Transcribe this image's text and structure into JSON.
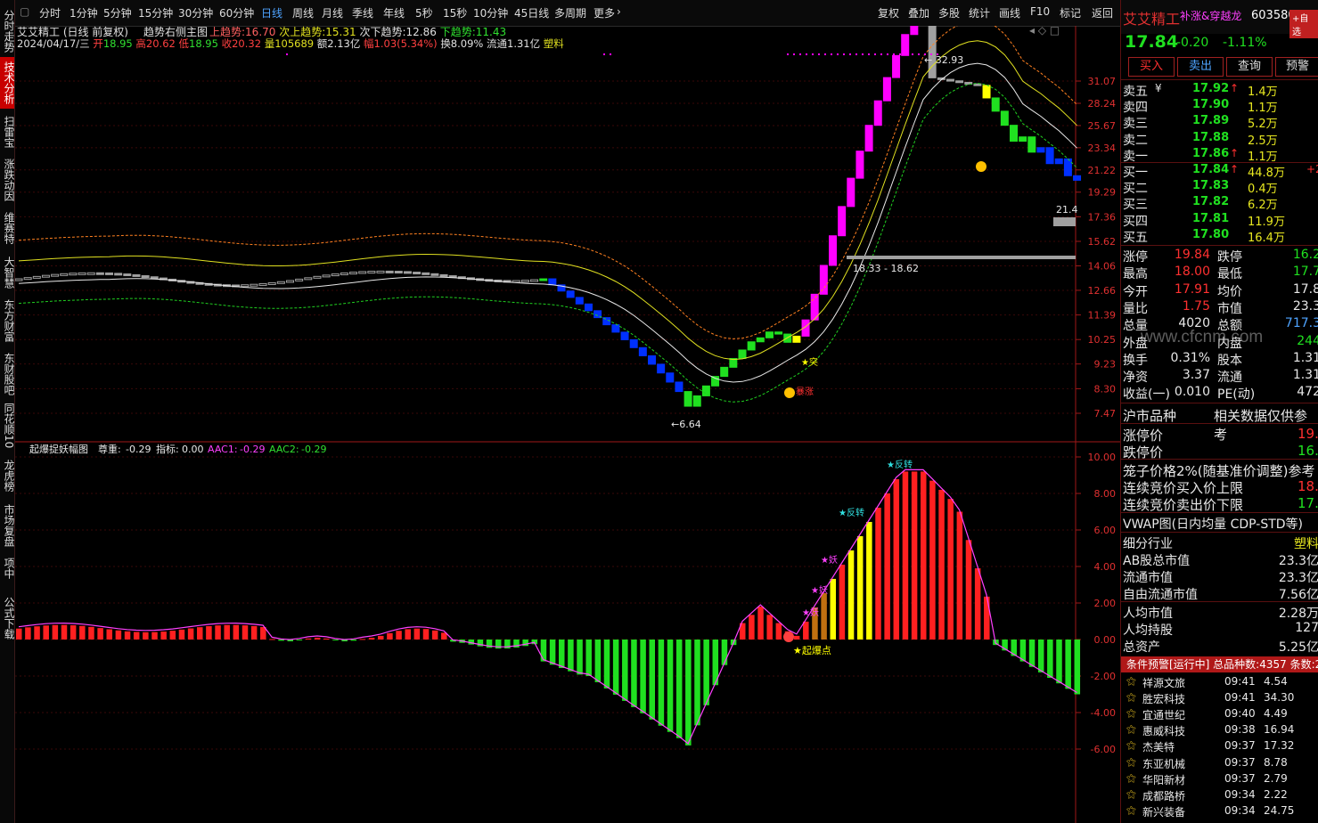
{
  "toolbar": {
    "periods": [
      "分时",
      "1分钟",
      "5分钟",
      "15分钟",
      "30分钟",
      "60分钟",
      "日线",
      "周线",
      "月线",
      "季线",
      "年线",
      "5秒",
      "15秒",
      "10分钟",
      "45日线",
      "多周期",
      "更多"
    ],
    "active": "日线",
    "actions": [
      "复权",
      "叠加",
      "多股",
      "统计",
      "画线",
      "F10",
      "标记",
      "返回"
    ]
  },
  "sidebar": {
    "tabs": [
      "分时走势",
      "技术分析",
      "扫雷宝",
      "涨跌动因",
      "维赛特",
      "大智慧",
      "东方财富",
      "东财股吧",
      "同花顺10",
      "龙虎榜",
      "市场复盘",
      "项中",
      "公式下载"
    ],
    "selected": "技术分析"
  },
  "main_chart": {
    "header_title": "艾艾精工 (日线 前复权)",
    "indicator_name": "趋势右侧主图",
    "ind1_label": "上趋势:",
    "ind1_value": "16.70",
    "ind2_label": "次上趋势:",
    "ind2_value": "15.31",
    "ind3_label": "次下趋势:",
    "ind3_value": "12.86",
    "ind4_label": "下趋势:",
    "ind4_value": "11.43",
    "date": "2024/04/17/三",
    "open_label": "开",
    "open": "18.95",
    "high_label": "高",
    "high": "20.62",
    "low_label": "低",
    "low": "18.95",
    "close_label": "收",
    "close": "20.32",
    "vol_label": "量",
    "vol": "105689",
    "amt_label": "额",
    "amt": "2.13亿",
    "chg_label": "幅",
    "chg": "1.03(5.34%)",
    "turnover": "换8.09%",
    "float": "流通1.31亿",
    "sector": "塑料",
    "high_marker": "32.93",
    "low_marker": "6.64",
    "range_label": "18.33 - 18.62",
    "right_price_tag": "21.4",
    "label_tu": "突",
    "label_bao": "暴涨",
    "axis": [
      "31.07",
      "28.24",
      "25.67",
      "23.34",
      "21.22",
      "19.29",
      "17.36",
      "15.62",
      "14.06",
      "12.66",
      "11.39",
      "10.25",
      "9.23",
      "8.30",
      "7.47"
    ]
  },
  "sub_chart": {
    "title": "起爆捉妖幅图",
    "zunzhong_label": "尊重:",
    "zunzhong": "-0.29",
    "zhibiao_label": "指标:",
    "zhibiao": "0.00",
    "aac1_label": "AAC1:",
    "aac1": "-0.29",
    "aac2_label": "AAC2:",
    "aac2": "-0.29",
    "axis": [
      "10.00",
      "8.00",
      "6.00",
      "4.00",
      "2.00",
      "0.00",
      "-2.00",
      "-4.00",
      "-6.00"
    ],
    "label_qibao": "★起爆点",
    "label_fanzhuan1": "★反转",
    "label_fanzhuan2": "★反转",
    "label_yao1": "★妖",
    "label_yao2": "★妖",
    "label_yao3": "★妖"
  },
  "panel": {
    "name": "艾艾精工",
    "tags": "补涨&穿越龙",
    "code": "603580",
    "add_btn": "+自选",
    "price": "17.84",
    "change": "-0.20",
    "pct": "-1.11%",
    "btn_buy": "买入",
    "btn_sell": "卖出",
    "btn_query": "查询",
    "btn_alert": "预警",
    "asks": [
      {
        "label": "卖五",
        "price": "17.92",
        "vol": "1.4万",
        "mark": "¥"
      },
      {
        "label": "卖四",
        "price": "17.90",
        "vol": "1.1万",
        "mark": ""
      },
      {
        "label": "卖三",
        "price": "17.89",
        "vol": "5.2万",
        "mark": ""
      },
      {
        "label": "卖二",
        "price": "17.88",
        "vol": "2.5万",
        "mark": ""
      },
      {
        "label": "卖一",
        "price": "17.86",
        "vol": "1.1万",
        "mark": "↑"
      }
    ],
    "bids": [
      {
        "label": "买一",
        "price": "17.84",
        "vol": "44.8万",
        "mark": "↑",
        "extra": "+2"
      },
      {
        "label": "买二",
        "price": "17.83",
        "vol": "0.4万",
        "mark": "",
        "extra": ""
      },
      {
        "label": "买三",
        "price": "17.82",
        "vol": "6.2万",
        "mark": "",
        "extra": ""
      },
      {
        "label": "买四",
        "price": "17.81",
        "vol": "11.9万",
        "mark": "",
        "extra": ""
      },
      {
        "label": "买五",
        "price": "17.80",
        "vol": "16.4万",
        "mark": "",
        "extra": ""
      }
    ],
    "stats": [
      {
        "l1": "涨停",
        "v1": "19.84",
        "l2": "跌停",
        "v2": "16.2"
      },
      {
        "l1": "最高",
        "v1": "18.00",
        "l2": "最低",
        "v2": "17.7"
      },
      {
        "l1": "今开",
        "v1": "17.91",
        "l2": "均价",
        "v2": "17.8"
      },
      {
        "l1": "量比",
        "v1": "1.75",
        "l2": "市值",
        "v2": "23.3"
      },
      {
        "l1": "总量",
        "v1": "4020",
        "l2": "总额",
        "v2": "717.3"
      },
      {
        "l1": "外盘",
        "v1": "",
        "l2": "内盘",
        "v2": "244"
      },
      {
        "l1": "换手",
        "v1": "0.31%",
        "l2": "股本",
        "v2": "1.31"
      },
      {
        "l1": "净资",
        "v1": "3.37",
        "l2": "流通",
        "v2": "1.31"
      },
      {
        "l1": "收益(一)",
        "v1": "0.010",
        "l2": "PE(动)",
        "v2": "472"
      }
    ],
    "watermark": "www.cfcnm.com",
    "hushi": "沪市品种",
    "hushi_note": "相关数据仅供参考",
    "rows2": [
      {
        "l": "涨停价",
        "v": "19.8"
      },
      {
        "l": "跌停价",
        "v": "16.2"
      }
    ],
    "cage": "笼子价格2%(随基准价调整)参考",
    "auction_buy": "连续竞价买入价上限",
    "auction_buy_v": "18.2",
    "auction_sell": "连续竞价卖出价下限",
    "auction_sell_v": "17.4",
    "vwap": "VWAP图(日内均量 CDP-STD等)",
    "info": [
      {
        "l": "细分行业",
        "v": "塑料"
      },
      {
        "l": "AB股总市值",
        "v": "23.3亿"
      },
      {
        "l": "流通市值",
        "v": "23.3亿"
      },
      {
        "l": "自由流通市值",
        "v": "7.56亿"
      },
      {
        "l": "人均市值",
        "v": "2.28万"
      },
      {
        "l": "人均持股",
        "v": "127"
      },
      {
        "l": "总资产",
        "v": "5.25亿"
      }
    ],
    "alert_bar": "条件预警[运行中] 总品种数:4357 条数:2",
    "watchlist": [
      {
        "name": "祥源文旅",
        "time": "09:41",
        "price": "4.54"
      },
      {
        "name": "胜宏科技",
        "time": "09:41",
        "price": "34.30"
      },
      {
        "name": "宜通世纪",
        "time": "09:40",
        "price": "4.49"
      },
      {
        "name": "惠威科技",
        "time": "09:38",
        "price": "16.94"
      },
      {
        "name": "杰美特",
        "time": "09:37",
        "price": "17.32"
      },
      {
        "name": "东亚机械",
        "time": "09:37",
        "price": "8.78"
      },
      {
        "name": "华阳新材",
        "time": "09:37",
        "price": "2.79"
      },
      {
        "name": "成都路桥",
        "time": "09:34",
        "price": "2.22"
      },
      {
        "name": "新兴装备",
        "time": "09:34",
        "price": "24.75"
      }
    ]
  },
  "colors": {
    "up": "#ff2020",
    "down": "#20e020",
    "magenta": "#ff00ff",
    "yellow": "#ffff00",
    "blue": "#0030ff",
    "gray": "#a0a0a0"
  }
}
